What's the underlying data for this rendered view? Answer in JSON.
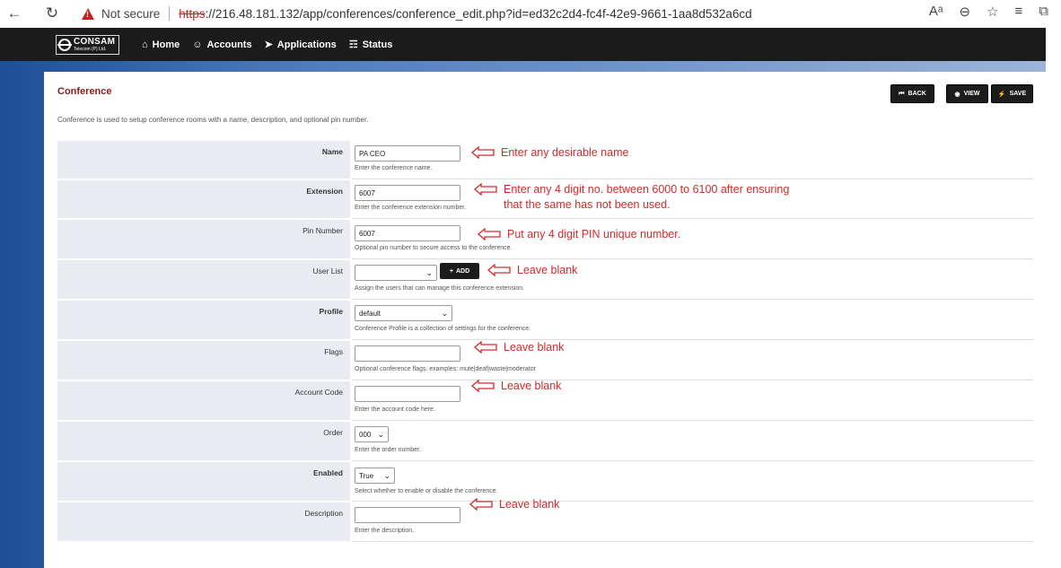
{
  "browser": {
    "back_icon": "←",
    "reload_icon": "↻",
    "security_label": "Not secure",
    "url_scheme": "https",
    "url_rest": "://216.48.181.132/app/conferences/conference_edit.php?id=ed32c2d4-fc4f-42e9-9661-1aa8d532a6cd",
    "tool_icons": [
      "Aᵃ",
      "⊖",
      "☆",
      "≡",
      "⧉"
    ]
  },
  "navbar": {
    "logo_main": "CONSAM",
    "logo_sub": "Telecom (P) Ltd.",
    "items": [
      {
        "label": "Home",
        "icon": "⌂"
      },
      {
        "label": "Accounts",
        "icon": "☺"
      },
      {
        "label": "Applications",
        "icon": "➤"
      },
      {
        "label": "Status",
        "icon": "☶"
      }
    ]
  },
  "page": {
    "title": "Conference",
    "description": "Conference is used to setup conference rooms with a name, description, and optional pin number.",
    "buttons": {
      "back": "BACK",
      "view": "VIEW",
      "save": "SAVE"
    }
  },
  "form": {
    "name": {
      "label": "Name",
      "value": "PA CEO",
      "hint": "Enter the conference name."
    },
    "extension": {
      "label": "Extension",
      "value": "6007",
      "hint": "Enter the conference extension number."
    },
    "pin": {
      "label": "Pin Number",
      "value": "6007",
      "hint": "Optional pin number to secure access to the conference."
    },
    "user_list": {
      "label": "User List",
      "value": "",
      "add_label": "ADD",
      "hint": "Assign the users that can manage this conference extension."
    },
    "profile": {
      "label": "Profile",
      "value": "default",
      "hint": "Conference Profile is a collection of settings for the conference."
    },
    "flags": {
      "label": "Flags",
      "value": "",
      "hint": "Optional conference flags. examples: mute|deaf|waste|moderator"
    },
    "account_code": {
      "label": "Account Code",
      "value": "",
      "hint": "Enter the account code here."
    },
    "order": {
      "label": "Order",
      "value": "000",
      "hint": "Enter the order number."
    },
    "enabled": {
      "label": "Enabled",
      "value": "True",
      "hint": "Select whether to enable or disable the conference."
    },
    "description": {
      "label": "Description",
      "value": "",
      "hint": "Enter the description."
    }
  },
  "annotations": {
    "name": "Enter any desirable name",
    "extension_line1": "Enter any 4 digit no. between 6000 to 6100 after ensuring",
    "extension_line2": "that the same has not been used.",
    "pin": "Put any 4 digit PIN unique number.",
    "user_list": "Leave blank",
    "flags": "Leave blank",
    "account_code": "Leave blank",
    "description": "Leave blank",
    "color": "#d42a2a"
  }
}
